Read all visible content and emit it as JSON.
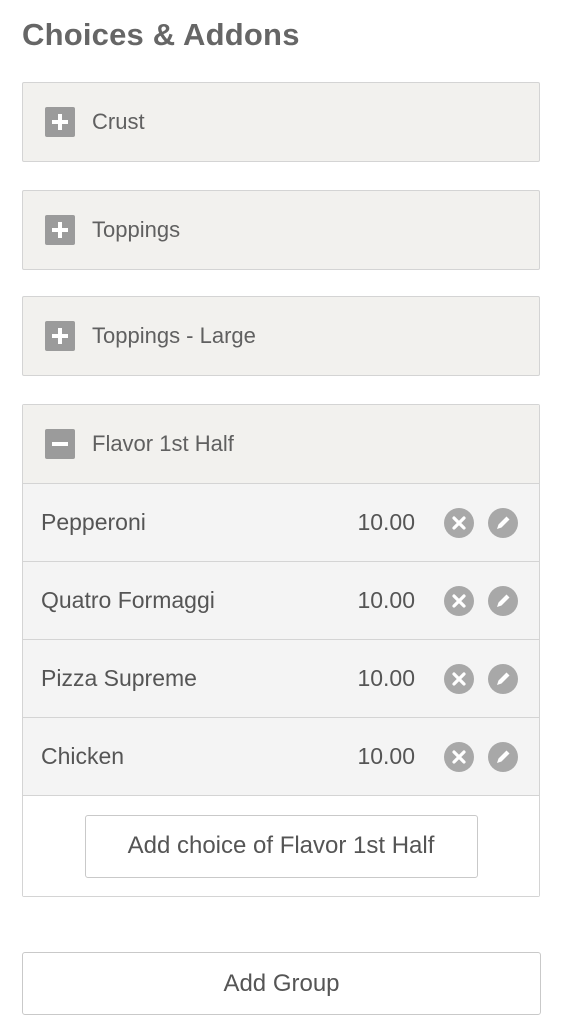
{
  "section": {
    "title": "Choices & Addons"
  },
  "groups": [
    {
      "label": "Crust",
      "state": "collapsed",
      "icon": "plus-icon"
    },
    {
      "label": "Toppings",
      "state": "collapsed",
      "icon": "plus-icon"
    },
    {
      "label": "Toppings - Large",
      "state": "collapsed",
      "icon": "plus-icon"
    },
    {
      "label": "Flavor 1st Half",
      "state": "expanded",
      "icon": "minus-icon",
      "choices": [
        {
          "name": "Pepperoni",
          "price": "10.00"
        },
        {
          "name": "Quatro Formaggi",
          "price": "10.00"
        },
        {
          "name": "Pizza Supreme",
          "price": "10.00"
        },
        {
          "name": "Chicken",
          "price": "10.00"
        }
      ],
      "add_choice_label": "Add choice of Flavor 1st Half"
    }
  ],
  "add_group_label": "Add Group",
  "colors": {
    "header_bg": "#f2f1ee",
    "row_bg": "#f4f4f4",
    "icon_gray": "#9b9b9b",
    "border": "#d4d4d4"
  }
}
